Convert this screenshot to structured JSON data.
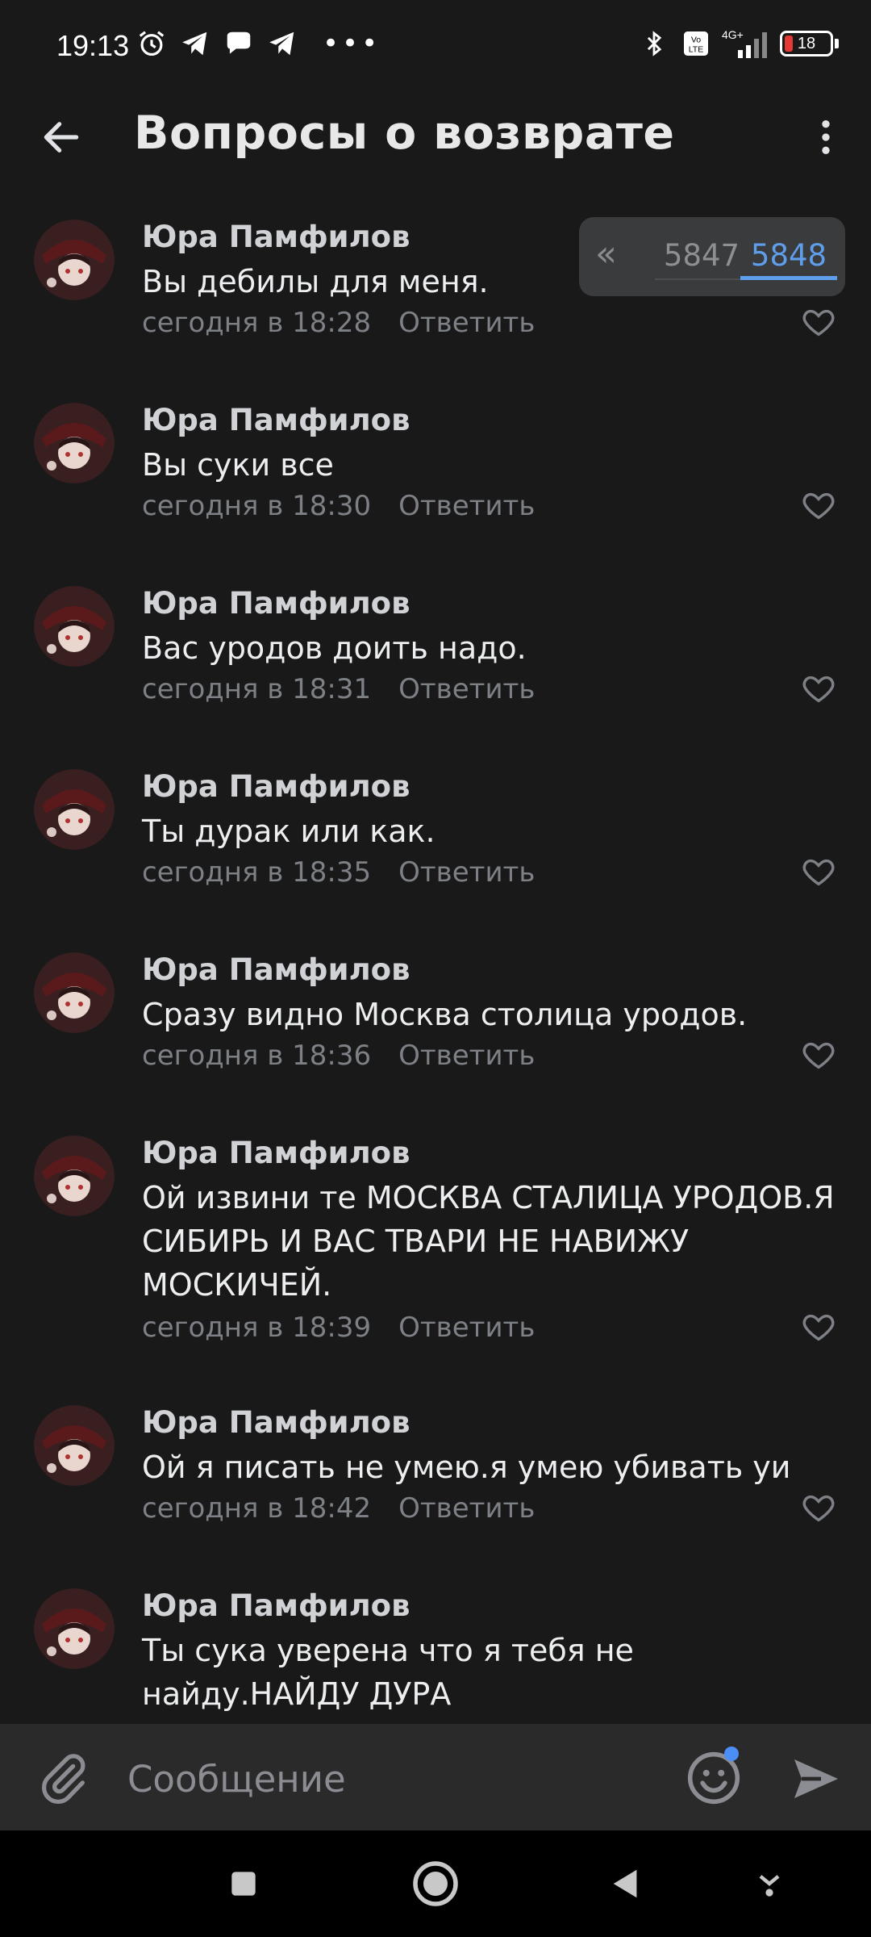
{
  "status_bar": {
    "time": "19:13",
    "left_icons": [
      "alarm-icon",
      "telegram-icon",
      "chat-bubble-icon",
      "telegram-icon"
    ],
    "right_icons": [
      "bluetooth-icon",
      "volte-icon",
      "signal-4g-icon"
    ],
    "network": "4G+",
    "battery": "18",
    "battery_level": 0.18
  },
  "header": {
    "title": "Вопросы о возврате"
  },
  "pager": {
    "back": "«",
    "prev_page": "5847",
    "current_page": "5848"
  },
  "comments": [
    {
      "author": "Юра Памфилов",
      "text": "Вы дебилы для меня.",
      "time": "сегодня в 18:28",
      "reply": "Ответить"
    },
    {
      "author": "Юра Памфилов",
      "text": "Вы суки все",
      "time": "сегодня в 18:30",
      "reply": "Ответить"
    },
    {
      "author": "Юра Памфилов",
      "text": "Вас уродов доить надо.",
      "time": "сегодня в 18:31",
      "reply": "Ответить"
    },
    {
      "author": "Юра Памфилов",
      "text": "Ты дурак или как.",
      "time": "сегодня в 18:35",
      "reply": "Ответить"
    },
    {
      "author": "Юра Памфилов",
      "text": "Сразу видно Москва столица уродов.",
      "time": "сегодня в 18:36",
      "reply": "Ответить"
    },
    {
      "author": "Юра Памфилов",
      "text": "Ой извини те МОСКВА СТАЛИЦА  УРОДОВ.Я СИБИРЬ И ВАС ТВАРИ  НЕ НАВИЖУ МОСКИЧЕЙ.",
      "time": "сегодня в 18:39",
      "reply": "Ответить"
    },
    {
      "author": "Юра Памфилов",
      "text": "Ой я писать не умею.я умею  убивать  уи",
      "time": "сегодня в 18:42",
      "reply": "Ответить"
    },
    {
      "author": "Юра Памфилов",
      "text": "Ты сука уверена что я тебя не найду.НАЙДУ ДУРА",
      "time": "",
      "reply": ""
    }
  ],
  "composer": {
    "placeholder": "Сообщение"
  },
  "colors": {
    "background": "#19191a",
    "accent": "#5e9eea",
    "secondary_text": "#7d8085"
  }
}
